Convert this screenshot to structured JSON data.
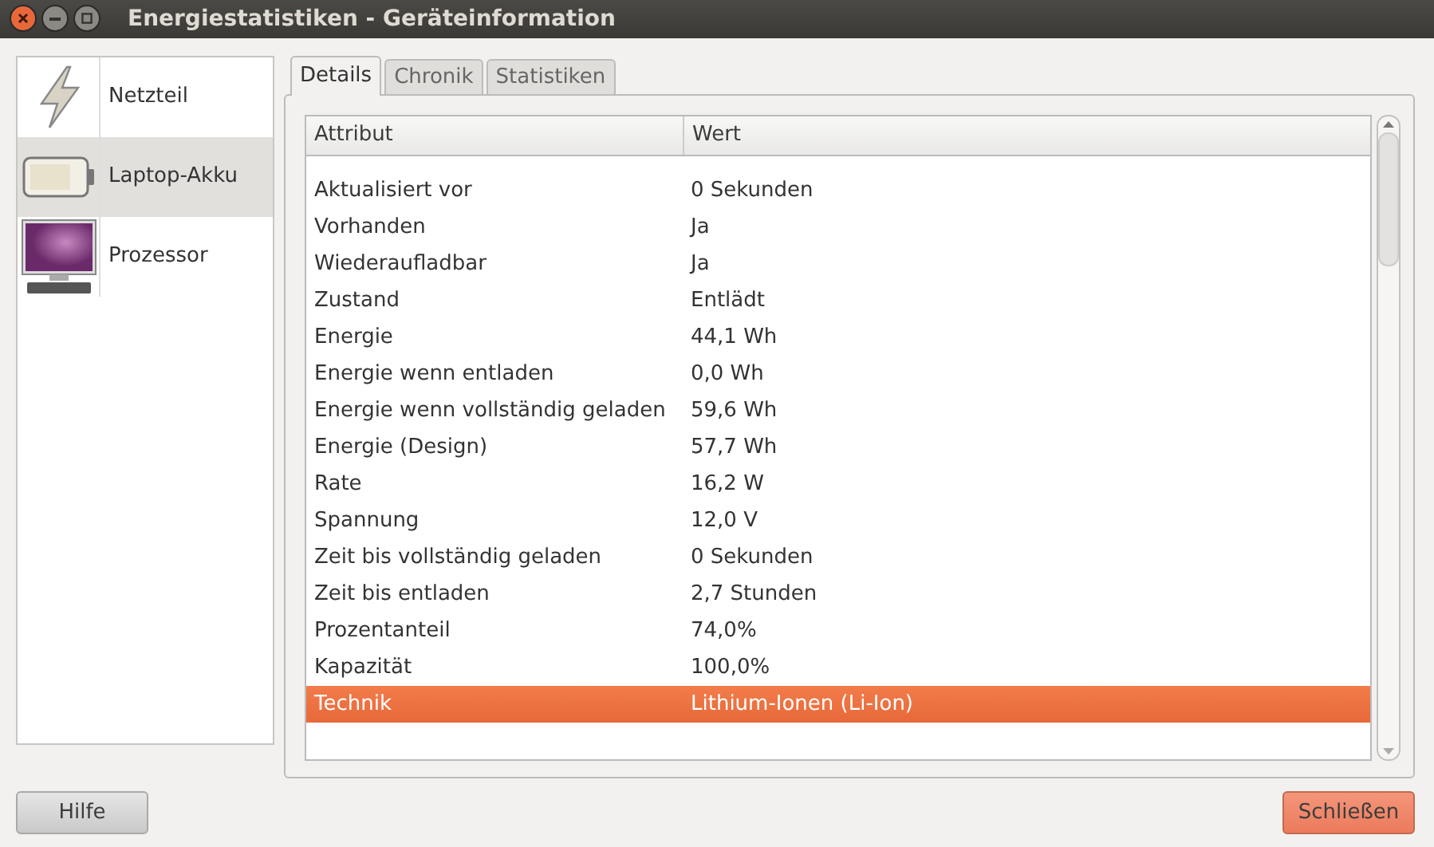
{
  "window": {
    "title": "Energiestatistiken - Geräteinformation"
  },
  "sidebar": {
    "items": [
      {
        "label": "Netzteil",
        "kind": "power",
        "selected": false
      },
      {
        "label": "Laptop-Akku",
        "kind": "battery",
        "selected": true
      },
      {
        "label": "Prozessor",
        "kind": "computer",
        "selected": false
      }
    ]
  },
  "tabs": [
    {
      "label": "Details",
      "selected": true
    },
    {
      "label": "Chronik",
      "selected": false
    },
    {
      "label": "Statistiken",
      "selected": false
    }
  ],
  "table": {
    "columns": [
      "Attribut",
      "Wert"
    ],
    "rows": [
      {
        "attribute": "Aktualisiert vor",
        "value": "0 Sekunden",
        "selected": false
      },
      {
        "attribute": "Vorhanden",
        "value": "Ja",
        "selected": false
      },
      {
        "attribute": "Wiederaufladbar",
        "value": "Ja",
        "selected": false
      },
      {
        "attribute": "Zustand",
        "value": "Entlädt",
        "selected": false
      },
      {
        "attribute": "Energie",
        "value": "44,1 Wh",
        "selected": false
      },
      {
        "attribute": "Energie wenn entladen",
        "value": "0,0 Wh",
        "selected": false
      },
      {
        "attribute": "Energie wenn vollständig geladen",
        "value": "59,6 Wh",
        "selected": false
      },
      {
        "attribute": "Energie (Design)",
        "value": "57,7 Wh",
        "selected": false
      },
      {
        "attribute": "Rate",
        "value": "16,2 W",
        "selected": false
      },
      {
        "attribute": "Spannung",
        "value": "12,0 V",
        "selected": false
      },
      {
        "attribute": "Zeit bis vollständig geladen",
        "value": "0 Sekunden",
        "selected": false
      },
      {
        "attribute": "Zeit bis entladen",
        "value": "2,7 Stunden",
        "selected": false
      },
      {
        "attribute": "Prozentanteil",
        "value": "74,0%",
        "selected": false
      },
      {
        "attribute": "Kapazität",
        "value": "100,0%",
        "selected": false
      },
      {
        "attribute": "Technik",
        "value": "Lithium-Ionen (Li-Ion)",
        "selected": true
      }
    ]
  },
  "buttons": [
    {
      "label": "Hilfe",
      "kind": "normal"
    },
    {
      "label": "Schließen",
      "kind": "default"
    }
  ]
}
